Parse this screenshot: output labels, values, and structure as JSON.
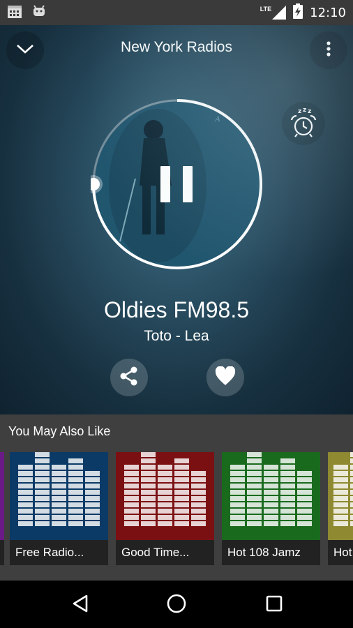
{
  "status_bar": {
    "time": "12:10",
    "network": "LTE",
    "icons": [
      "calendar-icon",
      "android-icon",
      "signal-icon",
      "battery-charging-icon"
    ]
  },
  "header": {
    "title": "New York Radios",
    "collapse_icon": "chevron-down-icon",
    "menu_icon": "more-vert-icon"
  },
  "player": {
    "station": "Oldies FM98.5",
    "track": "Toto - Lea",
    "state": "playing",
    "progress": 0.75,
    "pause_icon": "pause-icon",
    "sleep_timer_icon": "alarm-snooze-icon",
    "share_icon": "share-icon",
    "favorite_icon": "heart-icon"
  },
  "recommendations": {
    "title": "You May Also Like",
    "items": [
      {
        "label": "Free Radio...",
        "color": "#0b3a66"
      },
      {
        "label": "Good Time...",
        "color": "#7b1012"
      },
      {
        "label": "Hot 108 Jamz",
        "color": "#1a6a1e"
      },
      {
        "label": "Hot",
        "color": "#8f8a32"
      }
    ],
    "partial_left_color": "#6a1a86"
  },
  "nav_bar": {
    "back_icon": "back-triangle-icon",
    "home_icon": "home-circle-icon",
    "recents_icon": "recents-square-icon"
  },
  "colors": {
    "status_bar": "#3a3a3a",
    "hero": "#2a4f63",
    "recommendations_bg": "#3f3f3f"
  }
}
